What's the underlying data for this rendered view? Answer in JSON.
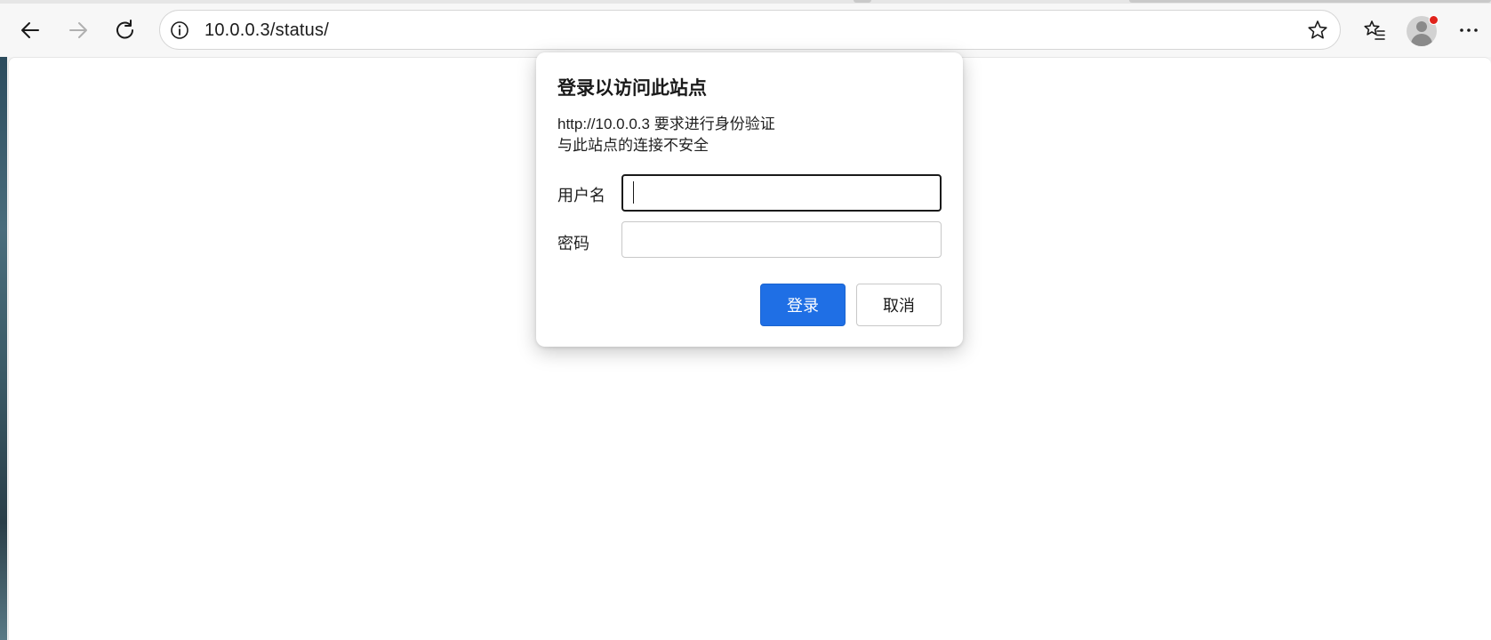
{
  "browser": {
    "address_url": "10.0.0.3/status/",
    "nav": {
      "back_icon": "arrow-left-icon",
      "forward_icon": "arrow-right-icon",
      "refresh_icon": "refresh-icon"
    },
    "profile": {
      "notification_color": "#e0231c"
    }
  },
  "auth_dialog": {
    "title": "登录以访问此站点",
    "message_line1": "http://10.0.0.3 要求进行身份验证",
    "message_line2": "与此站点的连接不安全",
    "username_label": "用户名",
    "username_value": "",
    "password_label": "密码",
    "password_value": "",
    "submit_label": "登录",
    "cancel_label": "取消",
    "accent_color": "#1f6fe5"
  }
}
